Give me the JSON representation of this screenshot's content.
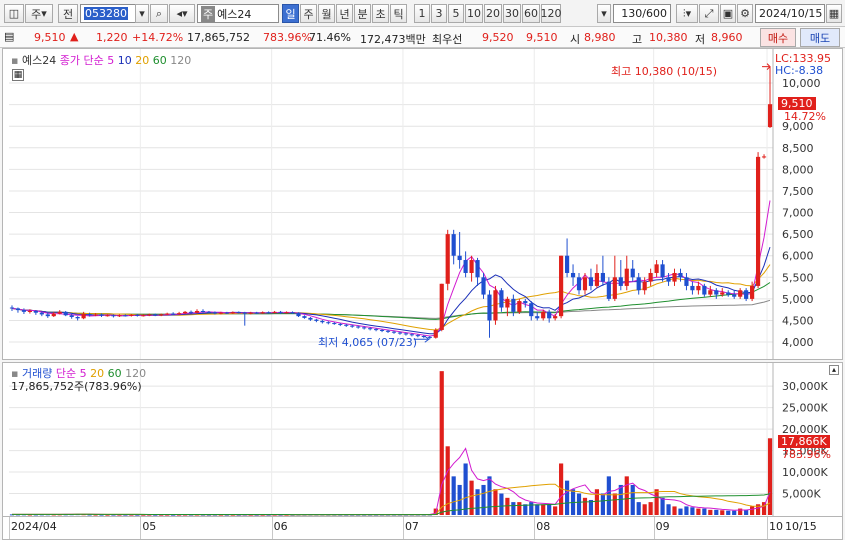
{
  "toolbar": {
    "market": "주",
    "period_mode": "전",
    "code": "053280",
    "stock_name": "예스24",
    "name_prefix": "주",
    "timeframes": [
      "일",
      "주",
      "월",
      "년",
      "분",
      "초",
      "틱"
    ],
    "active_timeframe": "일",
    "intervals": [
      "1",
      "3",
      "5",
      "10",
      "20",
      "30",
      "60",
      "120"
    ],
    "count": "130/600",
    "date": "2024/10/15"
  },
  "quote": {
    "price": "9,510",
    "arrow": "▲",
    "change": "1,220",
    "change_pct": "+14.72%",
    "volume": "17,865,752",
    "volume_pct": "783.96%",
    "ratio": "71.46%",
    "amount": "172,473백만",
    "best_label": "최우선",
    "best_ask": "9,520",
    "best_bid": "9,510",
    "open_label": "시",
    "open": "8,980",
    "high_label": "고",
    "high": "10,380",
    "low_label": "저",
    "low": "8,960",
    "buy_label": "매수",
    "sell_label": "매도"
  },
  "price_legend": {
    "title": "예스24",
    "kind": "종가",
    "ma_type": "단순",
    "ma_periods": [
      "5",
      "10",
      "20",
      "60",
      "120"
    ]
  },
  "price_info": {
    "lc": "LC:133.95",
    "hc": "HC:-8.38",
    "high_annot": "최고 10,380 (10/15)",
    "low_annot": "최저 4,065 (07/23)",
    "last_price": "9,510",
    "last_pct": "14.72%"
  },
  "volume_legend": {
    "title": "거래량",
    "ma_type": "단순",
    "ma_periods": [
      "5",
      "20",
      "60",
      "120"
    ],
    "value_line": "17,865,752주(783.96%)",
    "last_value": "17,866K",
    "last_pct": "783.96%"
  },
  "colors": {
    "up": "#e0201b",
    "down": "#1f4fd0",
    "ma5": "#d21bd0",
    "ma10": "#1a2fb8",
    "ma20": "#e0a000",
    "ma60": "#1f8f2f",
    "ma120": "#888888"
  },
  "chart_data": {
    "type": "candlestick",
    "price_axis": {
      "ticks": [
        "10,000",
        "9,500",
        "9,000",
        "8,500",
        "8,000",
        "7,500",
        "7,000",
        "6,500",
        "6,000",
        "5,500",
        "5,000",
        "4,500",
        "4,000"
      ],
      "ylim": [
        3700,
        10650
      ]
    },
    "volume_axis": {
      "ticks": [
        "30,000K",
        "25,000K",
        "20,000K",
        "15,000K",
        "10,000K",
        "5,000K"
      ],
      "ylim": [
        0,
        34000
      ]
    },
    "x_axis": {
      "labels": [
        "2024/04",
        "05",
        "06",
        "07",
        "08",
        "09",
        "10",
        "10/15"
      ]
    },
    "candles": [
      {
        "o": 4800,
        "c": 4780,
        "h": 4850,
        "l": 4720,
        "v": 150
      },
      {
        "o": 4780,
        "c": 4740,
        "h": 4800,
        "l": 4680,
        "v": 140
      },
      {
        "o": 4740,
        "c": 4700,
        "h": 4780,
        "l": 4650,
        "v": 160
      },
      {
        "o": 4700,
        "c": 4720,
        "h": 4760,
        "l": 4660,
        "v": 120
      },
      {
        "o": 4720,
        "c": 4680,
        "h": 4740,
        "l": 4630,
        "v": 130
      },
      {
        "o": 4680,
        "c": 4640,
        "h": 4700,
        "l": 4600,
        "v": 150
      },
      {
        "o": 4640,
        "c": 4600,
        "h": 4680,
        "l": 4560,
        "v": 170
      },
      {
        "o": 4600,
        "c": 4660,
        "h": 4700,
        "l": 4580,
        "v": 140
      },
      {
        "o": 4660,
        "c": 4700,
        "h": 4740,
        "l": 4640,
        "v": 150
      },
      {
        "o": 4700,
        "c": 4620,
        "h": 4720,
        "l": 4600,
        "v": 160
      },
      {
        "o": 4620,
        "c": 4580,
        "h": 4650,
        "l": 4540,
        "v": 180
      },
      {
        "o": 4580,
        "c": 4550,
        "h": 4600,
        "l": 4500,
        "v": 200
      },
      {
        "o": 4550,
        "c": 4650,
        "h": 4700,
        "l": 4530,
        "v": 180
      },
      {
        "o": 4650,
        "c": 4620,
        "h": 4680,
        "l": 4590,
        "v": 120
      },
      {
        "o": 4620,
        "c": 4640,
        "h": 4670,
        "l": 4600,
        "v": 110
      },
      {
        "o": 4640,
        "c": 4610,
        "h": 4660,
        "l": 4580,
        "v": 100
      },
      {
        "o": 4610,
        "c": 4620,
        "h": 4640,
        "l": 4590,
        "v": 90
      },
      {
        "o": 4620,
        "c": 4600,
        "h": 4640,
        "l": 4570,
        "v": 100
      },
      {
        "o": 4600,
        "c": 4620,
        "h": 4640,
        "l": 4580,
        "v": 90
      },
      {
        "o": 4620,
        "c": 4610,
        "h": 4640,
        "l": 4590,
        "v": 90
      },
      {
        "o": 4610,
        "c": 4630,
        "h": 4650,
        "l": 4590,
        "v": 90
      },
      {
        "o": 4630,
        "c": 4610,
        "h": 4650,
        "l": 4590,
        "v": 80
      },
      {
        "o": 4610,
        "c": 4620,
        "h": 4640,
        "l": 4590,
        "v": 80
      },
      {
        "o": 4620,
        "c": 4640,
        "h": 4660,
        "l": 4600,
        "v": 90
      },
      {
        "o": 4640,
        "c": 4620,
        "h": 4660,
        "l": 4600,
        "v": 80
      },
      {
        "o": 4620,
        "c": 4640,
        "h": 4660,
        "l": 4600,
        "v": 80
      },
      {
        "o": 4640,
        "c": 4660,
        "h": 4680,
        "l": 4620,
        "v": 90
      },
      {
        "o": 4660,
        "c": 4650,
        "h": 4690,
        "l": 4630,
        "v": 80
      },
      {
        "o": 4650,
        "c": 4670,
        "h": 4700,
        "l": 4630,
        "v": 90
      },
      {
        "o": 4670,
        "c": 4700,
        "h": 4720,
        "l": 4650,
        "v": 100
      },
      {
        "o": 4700,
        "c": 4680,
        "h": 4730,
        "l": 4660,
        "v": 90
      },
      {
        "o": 4680,
        "c": 4720,
        "h": 4760,
        "l": 4660,
        "v": 100
      },
      {
        "o": 4720,
        "c": 4700,
        "h": 4760,
        "l": 4680,
        "v": 90
      },
      {
        "o": 4700,
        "c": 4690,
        "h": 4720,
        "l": 4670,
        "v": 80
      },
      {
        "o": 4690,
        "c": 4660,
        "h": 4710,
        "l": 4640,
        "v": 90
      },
      {
        "o": 4660,
        "c": 4680,
        "h": 4700,
        "l": 4640,
        "v": 80
      },
      {
        "o": 4680,
        "c": 4670,
        "h": 4700,
        "l": 4650,
        "v": 80
      },
      {
        "o": 4670,
        "c": 4690,
        "h": 4710,
        "l": 4650,
        "v": 80
      },
      {
        "o": 4690,
        "c": 4680,
        "h": 4710,
        "l": 4660,
        "v": 70
      },
      {
        "o": 4680,
        "c": 4660,
        "h": 4700,
        "l": 4380,
        "v": 90
      },
      {
        "o": 4660,
        "c": 4680,
        "h": 4700,
        "l": 4640,
        "v": 70
      },
      {
        "o": 4680,
        "c": 4670,
        "h": 4700,
        "l": 4650,
        "v": 70
      },
      {
        "o": 4670,
        "c": 4690,
        "h": 4710,
        "l": 4650,
        "v": 70
      },
      {
        "o": 4690,
        "c": 4680,
        "h": 4710,
        "l": 4660,
        "v": 70
      },
      {
        "o": 4680,
        "c": 4700,
        "h": 4720,
        "l": 4660,
        "v": 80
      },
      {
        "o": 4700,
        "c": 4680,
        "h": 4720,
        "l": 4650,
        "v": 70
      },
      {
        "o": 4680,
        "c": 4690,
        "h": 4710,
        "l": 4660,
        "v": 70
      },
      {
        "o": 4690,
        "c": 4670,
        "h": 4710,
        "l": 4650,
        "v": 70
      },
      {
        "o": 4670,
        "c": 4600,
        "h": 4690,
        "l": 4580,
        "v": 90
      },
      {
        "o": 4600,
        "c": 4560,
        "h": 4620,
        "l": 4540,
        "v": 90
      },
      {
        "o": 4560,
        "c": 4520,
        "h": 4580,
        "l": 4490,
        "v": 100
      },
      {
        "o": 4520,
        "c": 4490,
        "h": 4540,
        "l": 4460,
        "v": 100
      },
      {
        "o": 4490,
        "c": 4460,
        "h": 4510,
        "l": 4430,
        "v": 100
      },
      {
        "o": 4460,
        "c": 4440,
        "h": 4480,
        "l": 4410,
        "v": 90
      },
      {
        "o": 4440,
        "c": 4420,
        "h": 4460,
        "l": 4400,
        "v": 90
      },
      {
        "o": 4420,
        "c": 4400,
        "h": 4440,
        "l": 4370,
        "v": 90
      },
      {
        "o": 4400,
        "c": 4380,
        "h": 4420,
        "l": 4350,
        "v": 90
      },
      {
        "o": 4380,
        "c": 4360,
        "h": 4400,
        "l": 4330,
        "v": 90
      },
      {
        "o": 4360,
        "c": 4340,
        "h": 4380,
        "l": 4310,
        "v": 90
      },
      {
        "o": 4340,
        "c": 4320,
        "h": 4360,
        "l": 4290,
        "v": 90
      },
      {
        "o": 4320,
        "c": 4300,
        "h": 4340,
        "l": 4270,
        "v": 90
      },
      {
        "o": 4300,
        "c": 4280,
        "h": 4320,
        "l": 4250,
        "v": 90
      },
      {
        "o": 4280,
        "c": 4260,
        "h": 4300,
        "l": 4230,
        "v": 100
      },
      {
        "o": 4260,
        "c": 4240,
        "h": 4280,
        "l": 4210,
        "v": 100
      },
      {
        "o": 4240,
        "c": 4220,
        "h": 4260,
        "l": 4190,
        "v": 100
      },
      {
        "o": 4220,
        "c": 4200,
        "h": 4240,
        "l": 4170,
        "v": 100
      },
      {
        "o": 4200,
        "c": 4180,
        "h": 4220,
        "l": 4150,
        "v": 100
      },
      {
        "o": 4180,
        "c": 4160,
        "h": 4200,
        "l": 4130,
        "v": 110
      },
      {
        "o": 4160,
        "c": 4140,
        "h": 4180,
        "l": 4110,
        "v": 110
      },
      {
        "o": 4140,
        "c": 4120,
        "h": 4160,
        "l": 4090,
        "v": 110
      },
      {
        "o": 4120,
        "c": 4100,
        "h": 4140,
        "l": 4065,
        "v": 120
      },
      {
        "o": 4100,
        "c": 4280,
        "h": 4320,
        "l": 4080,
        "v": 1500
      },
      {
        "o": 4280,
        "c": 5350,
        "h": 5350,
        "l": 4250,
        "v": 33500
      },
      {
        "o": 5350,
        "c": 6500,
        "h": 6600,
        "l": 5200,
        "v": 16000
      },
      {
        "o": 6500,
        "c": 6000,
        "h": 6600,
        "l": 5800,
        "v": 9000
      },
      {
        "o": 6000,
        "c": 5900,
        "h": 6550,
        "l": 5700,
        "v": 7000
      },
      {
        "o": 5900,
        "c": 5600,
        "h": 6100,
        "l": 5500,
        "v": 12000
      },
      {
        "o": 5600,
        "c": 5900,
        "h": 6000,
        "l": 5400,
        "v": 8000
      },
      {
        "o": 5900,
        "c": 5500,
        "h": 5950,
        "l": 5300,
        "v": 6000
      },
      {
        "o": 5500,
        "c": 5100,
        "h": 5600,
        "l": 5000,
        "v": 7000
      },
      {
        "o": 5100,
        "c": 4500,
        "h": 5200,
        "l": 4100,
        "v": 9000
      },
      {
        "o": 4500,
        "c": 5200,
        "h": 5300,
        "l": 4400,
        "v": 6000
      },
      {
        "o": 5200,
        "c": 4800,
        "h": 5250,
        "l": 4700,
        "v": 5000
      },
      {
        "o": 4800,
        "c": 5000,
        "h": 5050,
        "l": 4600,
        "v": 4000
      },
      {
        "o": 5000,
        "c": 4700,
        "h": 5100,
        "l": 4600,
        "v": 3000
      },
      {
        "o": 4700,
        "c": 4950,
        "h": 5000,
        "l": 4650,
        "v": 3000
      },
      {
        "o": 4950,
        "c": 4900,
        "h": 5000,
        "l": 4800,
        "v": 2500
      },
      {
        "o": 4900,
        "c": 4600,
        "h": 4950,
        "l": 4500,
        "v": 3000
      },
      {
        "o": 4600,
        "c": 4550,
        "h": 4700,
        "l": 4500,
        "v": 2500
      },
      {
        "o": 4550,
        "c": 4700,
        "h": 4750,
        "l": 4500,
        "v": 2500
      },
      {
        "o": 4700,
        "c": 4550,
        "h": 4750,
        "l": 4450,
        "v": 2500
      },
      {
        "o": 4550,
        "c": 4600,
        "h": 4650,
        "l": 4500,
        "v": 2000
      },
      {
        "o": 4600,
        "c": 6000,
        "h": 6000,
        "l": 4550,
        "v": 12000
      },
      {
        "o": 6000,
        "c": 5600,
        "h": 6400,
        "l": 5500,
        "v": 8000
      },
      {
        "o": 5600,
        "c": 5500,
        "h": 5800,
        "l": 5300,
        "v": 6000
      },
      {
        "o": 5500,
        "c": 5200,
        "h": 5600,
        "l": 5100,
        "v": 5000
      },
      {
        "o": 5200,
        "c": 5500,
        "h": 5600,
        "l": 5100,
        "v": 4000
      },
      {
        "o": 5500,
        "c": 5300,
        "h": 5700,
        "l": 5200,
        "v": 3500
      },
      {
        "o": 5300,
        "c": 5600,
        "h": 5800,
        "l": 5250,
        "v": 6000
      },
      {
        "o": 5600,
        "c": 5400,
        "h": 6000,
        "l": 5300,
        "v": 5000
      },
      {
        "o": 5400,
        "c": 5000,
        "h": 5500,
        "l": 4950,
        "v": 9000
      },
      {
        "o": 5000,
        "c": 5500,
        "h": 6000,
        "l": 4950,
        "v": 5000
      },
      {
        "o": 5500,
        "c": 5300,
        "h": 5900,
        "l": 5200,
        "v": 7000
      },
      {
        "o": 5300,
        "c": 5700,
        "h": 6000,
        "l": 5200,
        "v": 9000
      },
      {
        "o": 5700,
        "c": 5500,
        "h": 5900,
        "l": 5400,
        "v": 7000
      },
      {
        "o": 5500,
        "c": 5200,
        "h": 5600,
        "l": 5100,
        "v": 3000
      },
      {
        "o": 5200,
        "c": 5400,
        "h": 5500,
        "l": 5100,
        "v": 2500
      },
      {
        "o": 5400,
        "c": 5600,
        "h": 5700,
        "l": 5300,
        "v": 3000
      },
      {
        "o": 5600,
        "c": 5800,
        "h": 5900,
        "l": 5500,
        "v": 6000
      },
      {
        "o": 5800,
        "c": 5500,
        "h": 5900,
        "l": 5400,
        "v": 4000
      },
      {
        "o": 5500,
        "c": 5400,
        "h": 5600,
        "l": 5300,
        "v": 2500
      },
      {
        "o": 5400,
        "c": 5600,
        "h": 5700,
        "l": 5300,
        "v": 2000
      },
      {
        "o": 5600,
        "c": 5500,
        "h": 5700,
        "l": 5400,
        "v": 1500
      },
      {
        "o": 5500,
        "c": 5300,
        "h": 5600,
        "l": 5200,
        "v": 2000
      },
      {
        "o": 5300,
        "c": 5200,
        "h": 5400,
        "l": 5100,
        "v": 1800
      },
      {
        "o": 5200,
        "c": 5300,
        "h": 5400,
        "l": 5100,
        "v": 1500
      },
      {
        "o": 5300,
        "c": 5100,
        "h": 5350,
        "l": 5050,
        "v": 1500
      },
      {
        "o": 5100,
        "c": 5200,
        "h": 5300,
        "l": 5050,
        "v": 1200
      },
      {
        "o": 5200,
        "c": 5100,
        "h": 5250,
        "l": 5000,
        "v": 1200
      },
      {
        "o": 5100,
        "c": 5150,
        "h": 5250,
        "l": 5050,
        "v": 1100
      },
      {
        "o": 5150,
        "c": 5100,
        "h": 5200,
        "l": 5050,
        "v": 1000
      },
      {
        "o": 5100,
        "c": 5050,
        "h": 5200,
        "l": 5000,
        "v": 1000
      },
      {
        "o": 5050,
        "c": 5200,
        "h": 5250,
        "l": 5000,
        "v": 1500
      },
      {
        "o": 5200,
        "c": 5000,
        "h": 5250,
        "l": 4950,
        "v": 1200
      },
      {
        "o": 5000,
        "c": 5300,
        "h": 5400,
        "l": 4950,
        "v": 2000
      },
      {
        "o": 5300,
        "c": 8290,
        "h": 8400,
        "l": 5250,
        "v": 2500
      },
      {
        "o": 8290,
        "c": 8300,
        "h": 8350,
        "l": 8250,
        "v": 3000
      },
      {
        "o": 8980,
        "c": 9510,
        "h": 10380,
        "l": 8960,
        "v": 17866
      }
    ]
  }
}
